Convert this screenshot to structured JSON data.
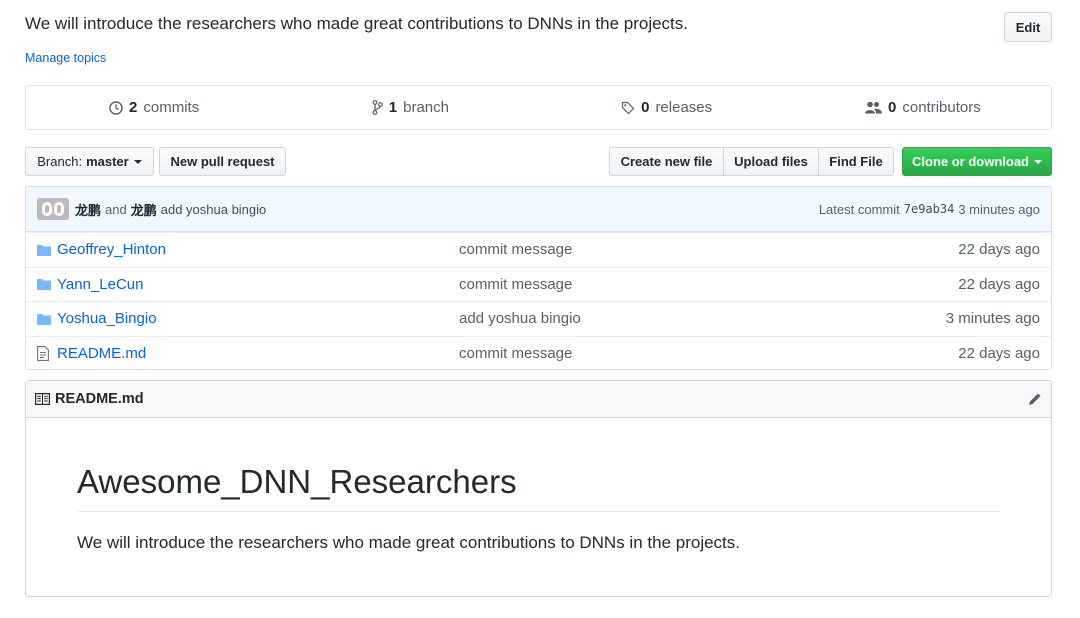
{
  "repo": {
    "description": "We will introduce the researchers who made great contributions to DNNs in the projects.",
    "edit_label": "Edit",
    "manage_topics": "Manage topics"
  },
  "summary": {
    "commits_count": "2",
    "commits_label": "commits",
    "branch_count": "1",
    "branch_label": "branch",
    "releases_count": "0",
    "releases_label": "releases",
    "contributors_count": "0",
    "contributors_label": "contributors"
  },
  "toolbar": {
    "branch_prefix": "Branch:",
    "branch_name": "master",
    "new_pull_request": "New pull request",
    "create_new_file": "Create new file",
    "upload_files": "Upload files",
    "find_file": "Find File",
    "clone_or_download": "Clone or download"
  },
  "latest_commit": {
    "author1": "龙鹏",
    "and_word": "and",
    "author2": "龙鹏",
    "message": "add yoshua bingio",
    "prefix": "Latest commit",
    "sha": "7e9ab34",
    "age": "3 minutes ago"
  },
  "files": [
    {
      "type": "folder",
      "name": "Geoffrey_Hinton",
      "message": "commit message",
      "age": "22 days ago"
    },
    {
      "type": "folder",
      "name": "Yann_LeCun",
      "message": "commit message",
      "age": "22 days ago"
    },
    {
      "type": "folder",
      "name": "Yoshua_Bingio",
      "message": "add yoshua bingio",
      "age": "3 minutes ago"
    },
    {
      "type": "file",
      "name": "README.md",
      "message": "commit message",
      "age": "22 days ago"
    }
  ],
  "readme": {
    "filename": "README.md",
    "heading": "Awesome_DNN_Researchers",
    "body": "We will introduce the researchers who made great contributions to DNNs in the projects."
  },
  "icons": {
    "commits": "history-icon",
    "branch": "git-branch-icon",
    "releases": "tag-icon",
    "contributors": "people-icon",
    "folder": "folder-icon",
    "file": "file-icon",
    "readme": "book-icon",
    "edit": "pencil-icon"
  },
  "colors": {
    "link": "#0366d6",
    "clone_green": "#28a745",
    "commit_bar_bg": "#f1f8ff"
  }
}
